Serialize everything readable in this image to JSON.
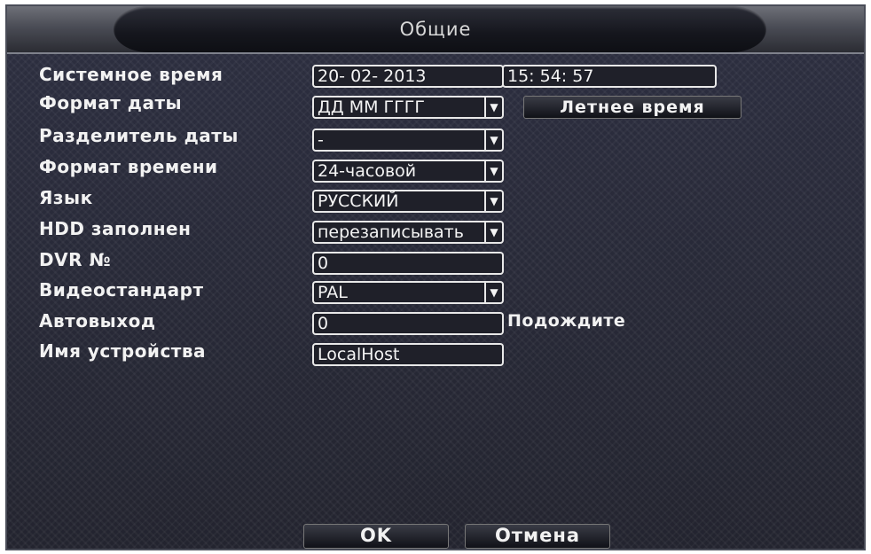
{
  "window": {
    "title": "Общие"
  },
  "fields": {
    "system_time": {
      "label": "Системное время",
      "date": "20- 02- 2013",
      "time": "15: 54: 57"
    },
    "date_format": {
      "label": "Формат даты",
      "value": "ДД ММ ГГГГ"
    },
    "dst_button": "Летнее время",
    "date_separator": {
      "label": "Разделитель даты",
      "value": "-"
    },
    "time_format": {
      "label": "Формат времени",
      "value": "24-часовой"
    },
    "language": {
      "label": "Язык",
      "value": "РУССКИЙ"
    },
    "hdd_full": {
      "label": "HDD заполнен",
      "value": "перезаписывать"
    },
    "dvr_no": {
      "label": "DVR №",
      "value": "0"
    },
    "video_standard": {
      "label": "Видеостандарт",
      "value": "PAL"
    },
    "auto_logout": {
      "label": "Автовыход",
      "value": "0",
      "unit": "Подождите"
    },
    "device_name": {
      "label": "Имя устройства",
      "value": "LocalHost"
    }
  },
  "buttons": {
    "ok": "OK",
    "cancel": "Отмена"
  },
  "icons": {
    "dropdown": "chevron-down-icon"
  }
}
